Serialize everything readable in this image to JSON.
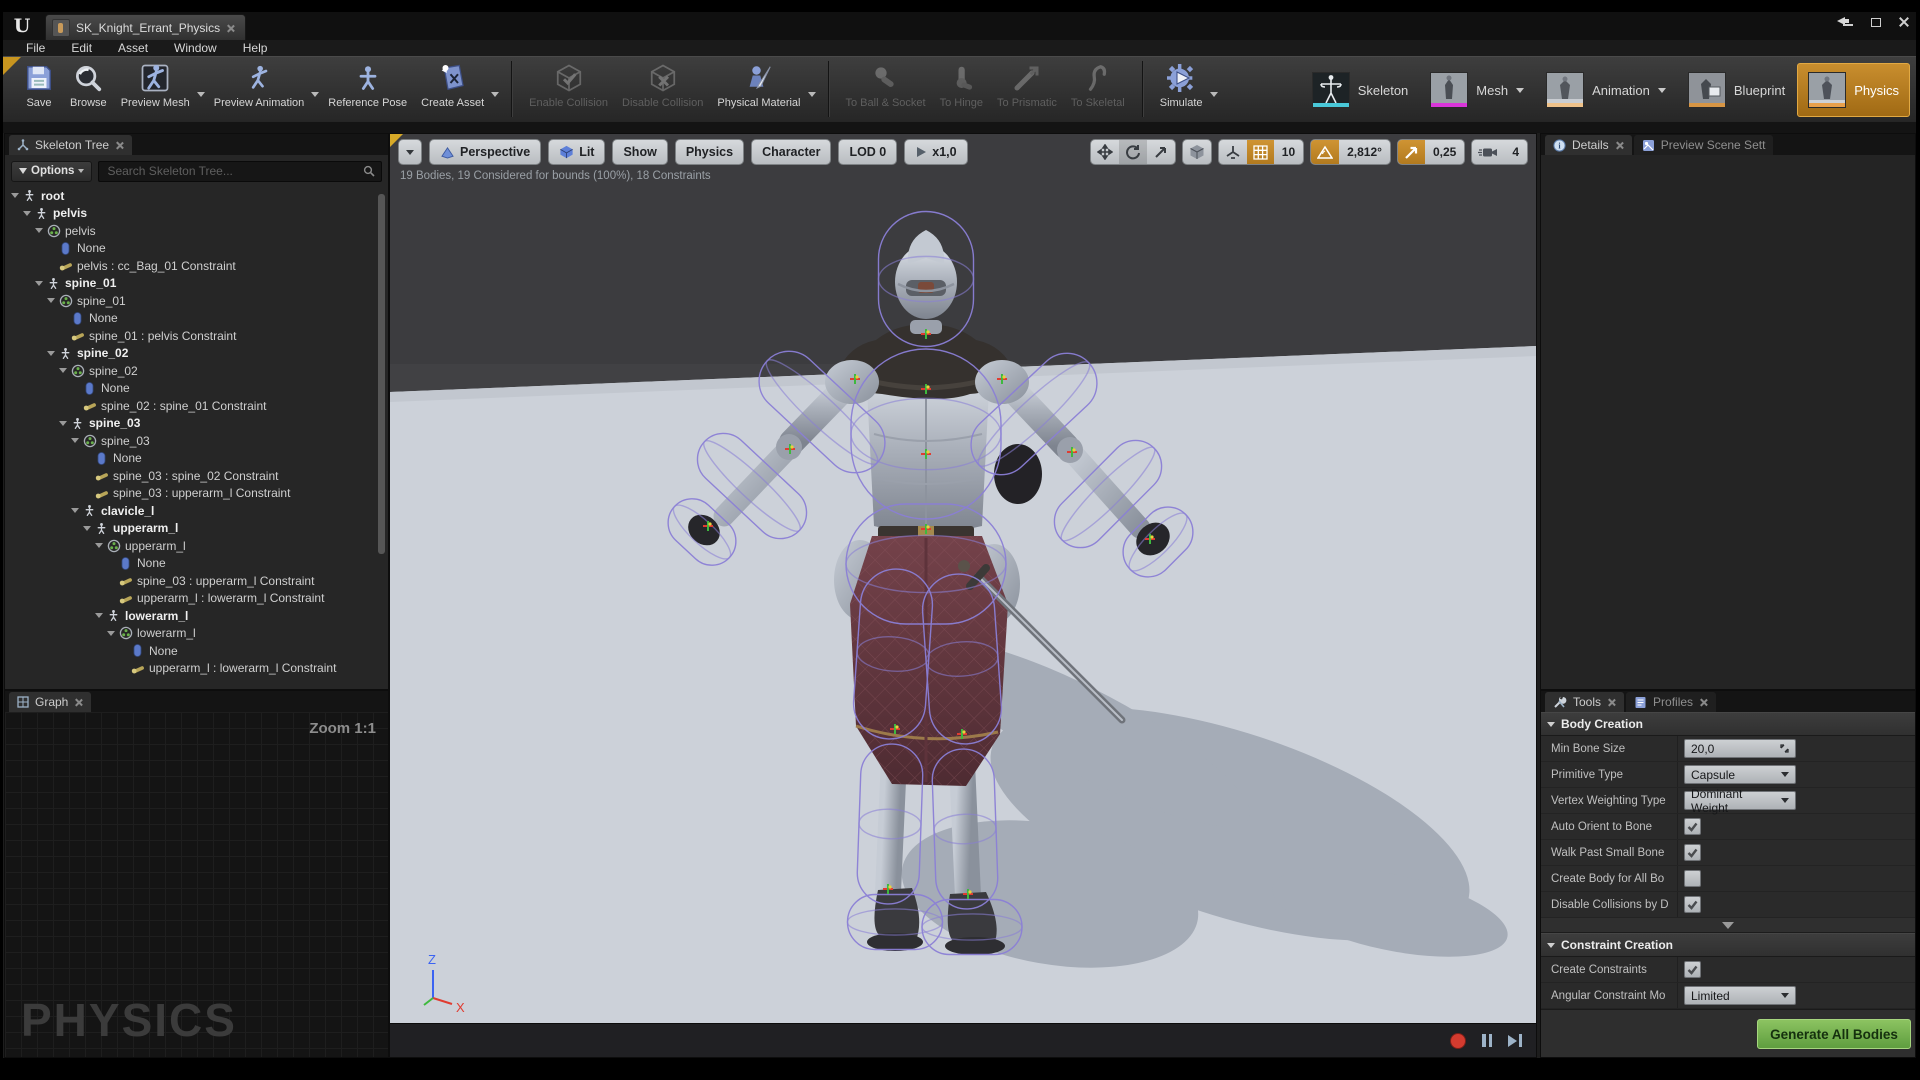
{
  "window": {
    "logo": "U",
    "tab_title": "SK_Knight_Errant_Physics",
    "menu": [
      "File",
      "Edit",
      "Asset",
      "Window",
      "Help"
    ]
  },
  "toolbar": {
    "groups": [
      [
        {
          "label": "Save",
          "icon": "save"
        },
        {
          "label": "Browse",
          "icon": "browse"
        },
        {
          "label": "Preview Mesh",
          "icon": "preview-mesh",
          "dropdown": true
        },
        {
          "label": "Preview Animation",
          "icon": "preview-animation",
          "dropdown": true
        },
        {
          "label": "Reference Pose",
          "icon": "reference-pose"
        },
        {
          "label": "Create Asset",
          "icon": "create-asset",
          "dropdown": true
        }
      ],
      [
        {
          "label": "Enable Collision",
          "icon": "enable-collision",
          "disabled": true
        },
        {
          "label": "Disable Collision",
          "icon": "disable-collision",
          "disabled": true
        },
        {
          "label": "Physical Material",
          "icon": "physical-material",
          "dropdown": true
        }
      ],
      [
        {
          "label": "To Ball & Socket",
          "icon": "ball-socket",
          "disabled": true
        },
        {
          "label": "To Hinge",
          "icon": "hinge",
          "disabled": true
        },
        {
          "label": "To Prismatic",
          "icon": "prismatic",
          "disabled": true
        },
        {
          "label": "To Skeletal",
          "icon": "skeletal",
          "disabled": true
        }
      ],
      [
        {
          "label": "Simulate",
          "icon": "simulate",
          "dropdown": true
        }
      ]
    ]
  },
  "modes": {
    "items": [
      {
        "label": "Skeleton",
        "thumb": "skeleton",
        "stripe": "#49c8d8"
      },
      {
        "label": "Mesh",
        "thumb": "mesh",
        "stripe": "#d935d9",
        "dropdown": true
      },
      {
        "label": "Animation",
        "thumb": "animation",
        "stripe": "#eec189",
        "dropdown": true
      },
      {
        "label": "Blueprint",
        "thumb": "blueprint",
        "stripe": "#d79544"
      },
      {
        "label": "Physics",
        "thumb": "physics",
        "stripe": "#e8a04c",
        "active": true
      }
    ]
  },
  "skeleton_tree": {
    "tab": "Skeleton Tree",
    "options_label": "Options",
    "search_placeholder": "Search Skeleton Tree...",
    "items": [
      {
        "level": 0,
        "type": "bone",
        "label": "root",
        "bold": true
      },
      {
        "level": 1,
        "type": "bone",
        "label": "pelvis",
        "bold": true
      },
      {
        "level": 2,
        "type": "body",
        "label": "pelvis"
      },
      {
        "level": 3,
        "type": "shape",
        "label": "None"
      },
      {
        "level": 3,
        "type": "constraint",
        "label": "pelvis : cc_Bag_01 Constraint"
      },
      {
        "level": 2,
        "type": "bone",
        "label": "spine_01",
        "bold": true
      },
      {
        "level": 3,
        "type": "body",
        "label": "spine_01"
      },
      {
        "level": 4,
        "type": "shape",
        "label": "None"
      },
      {
        "level": 4,
        "type": "constraint",
        "label": "spine_01 : pelvis Constraint"
      },
      {
        "level": 3,
        "type": "bone",
        "label": "spine_02",
        "bold": true
      },
      {
        "level": 4,
        "type": "body",
        "label": "spine_02"
      },
      {
        "level": 5,
        "type": "shape",
        "label": "None"
      },
      {
        "level": 5,
        "type": "constraint",
        "label": "spine_02 : spine_01 Constraint"
      },
      {
        "level": 4,
        "type": "bone",
        "label": "spine_03",
        "bold": true
      },
      {
        "level": 5,
        "type": "body",
        "label": "spine_03"
      },
      {
        "level": 6,
        "type": "shape",
        "label": "None"
      },
      {
        "level": 6,
        "type": "constraint",
        "label": "spine_03 : spine_02 Constraint"
      },
      {
        "level": 6,
        "type": "constraint",
        "label": "spine_03 : upperarm_l Constraint"
      },
      {
        "level": 5,
        "type": "bone",
        "label": "clavicle_l",
        "bold": true
      },
      {
        "level": 6,
        "type": "bone",
        "label": "upperarm_l",
        "bold": true
      },
      {
        "level": 7,
        "type": "body",
        "label": "upperarm_l"
      },
      {
        "level": 8,
        "type": "shape",
        "label": "None"
      },
      {
        "level": 8,
        "type": "constraint",
        "label": "spine_03 : upperarm_l Constraint"
      },
      {
        "level": 8,
        "type": "constraint",
        "label": "upperarm_l : lowerarm_l Constraint"
      },
      {
        "level": 7,
        "type": "bone",
        "label": "lowerarm_l",
        "bold": true
      },
      {
        "level": 8,
        "type": "body",
        "label": "lowerarm_l"
      },
      {
        "level": 9,
        "type": "shape",
        "label": "None"
      },
      {
        "level": 9,
        "type": "constraint",
        "label": "upperarm_l : lowerarm_l Constraint"
      }
    ]
  },
  "graph": {
    "tab": "Graph",
    "zoom_label": "Zoom 1:1",
    "watermark": "PHYSICS"
  },
  "viewport": {
    "buttons": [
      {
        "label": "Perspective",
        "icon": "perspective"
      },
      {
        "label": "Lit",
        "icon": "lit"
      },
      {
        "label": "Show"
      },
      {
        "label": "Physics"
      },
      {
        "label": "Character"
      },
      {
        "label": "LOD 0"
      },
      {
        "label": "x1,0",
        "icon": "play"
      }
    ],
    "stats": "19 Bodies, 19 Considered for bounds (100%), 18 Constraints",
    "snaps": {
      "grid": "10",
      "angle": "2,812°",
      "scale": "0,25",
      "camera": "4"
    },
    "axis": {
      "up": "Z",
      "right": "X"
    }
  },
  "details": {
    "tabs": [
      "Details",
      "Preview Scene Sett"
    ]
  },
  "tools": {
    "tabs": [
      "Tools",
      "Profiles"
    ],
    "sections": [
      {
        "title": "Body Creation",
        "rows": [
          {
            "label": "Min Bone Size",
            "type": "spin",
            "value": "20,0"
          },
          {
            "label": "Primitive Type",
            "type": "dropdown",
            "value": "Capsule"
          },
          {
            "label": "Vertex Weighting Type",
            "type": "dropdown",
            "value": "Dominant Weight"
          },
          {
            "label": "Auto Orient to Bone",
            "type": "check",
            "checked": true
          },
          {
            "label": "Walk Past Small Bone",
            "type": "check",
            "checked": true
          },
          {
            "label": "Create Body for All Bo",
            "type": "check",
            "checked": false
          },
          {
            "label": "Disable Collisions by D",
            "type": "check",
            "checked": true
          }
        ]
      },
      {
        "title": "Constraint Creation",
        "rows": [
          {
            "label": "Create Constraints",
            "type": "check",
            "checked": true
          },
          {
            "label": "Angular Constraint Mo",
            "type": "dropdown",
            "value": "Limited"
          }
        ]
      }
    ],
    "generate_label": "Generate All Bodies"
  },
  "colors": {
    "accent_orange": "#c98a2c",
    "physics_active": "#b5791e",
    "green_button": "#6fa84e",
    "capsule_violet": "#8b7fd6",
    "floor": "#ccd1d9"
  }
}
